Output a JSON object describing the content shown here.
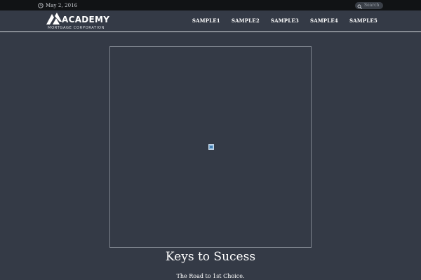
{
  "topbar": {
    "date": "May 2, 2016",
    "search_placeholder": "Search",
    "clock_icon": "clock-icon",
    "search_icon": "search-icon"
  },
  "header": {
    "logo_name": "ACADEMY",
    "logo_subtitle": "MORTGAGE CORPORATION",
    "nav": [
      "SAMPLE1",
      "SAMPLE2",
      "SAMPLE3",
      "SAMPLE4",
      "SAMPLE5"
    ]
  },
  "slide": {
    "title": "Keys to Sucess",
    "caption": "The Road to 1st Choice.",
    "image_icon": "broken-image-icon"
  },
  "colors": {
    "background": "#343a46",
    "topbar": "#111315",
    "text": "#ffffff"
  }
}
